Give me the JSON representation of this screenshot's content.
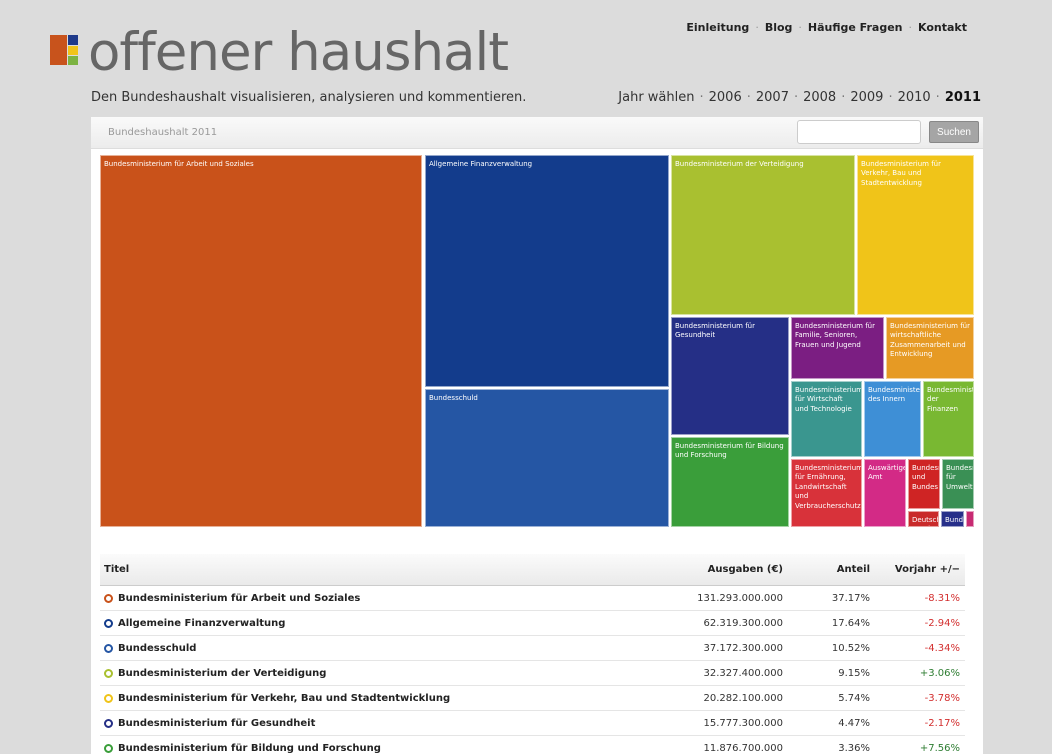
{
  "logo": {
    "text": "offener haushalt",
    "tagline": "Den Bundeshaushalt visualisieren, analysieren und kommentieren."
  },
  "nav": {
    "items": [
      "Einleitung",
      "Blog",
      "Häufige Fragen",
      "Kontakt"
    ],
    "separator": "·"
  },
  "years": {
    "label": "Jahr wählen",
    "items": [
      "2006",
      "2007",
      "2008",
      "2009",
      "2010",
      "2011"
    ],
    "active": "2011"
  },
  "panel": {
    "title": "Bundeshaushalt 2011",
    "search_placeholder": "",
    "search_button": "Suchen"
  },
  "treemap": [
    {
      "label": "Bundesministerium für Arbeit und Soziales",
      "color": "#c9521a"
    },
    {
      "label": "Allgemeine Finanzverwaltung",
      "color": "#133c8c"
    },
    {
      "label": "Bundesschuld",
      "color": "#2556a4"
    },
    {
      "label": "Bundesministerium der Verteidigung",
      "color": "#a9c030"
    },
    {
      "label": "Bundesministerium für Verkehr, Bau und Stadtentwicklung",
      "color": "#f0c419"
    },
    {
      "label": "Bundesministerium für Gesundheit",
      "color": "#252f86"
    },
    {
      "label": "Bundesministerium für Familie, Senioren, Frauen und Jugend",
      "color": "#7b1e82"
    },
    {
      "label": "Bundesministerium für wirtschaftliche Zusammenarbeit und Entwicklung",
      "color": "#e69a24"
    },
    {
      "label": "Bundesministerium für Bildung und Forschung",
      "color": "#3a9e3a"
    },
    {
      "label": "Bundesministerium für Wirtschaft und Technologie",
      "color": "#3a968f"
    },
    {
      "label": "Bundesministerium des Innern",
      "color": "#3e8fd6"
    },
    {
      "label": "Bundesministerium der Finanzen",
      "color": "#79b832"
    },
    {
      "label": "Bundesministerium für Ernährung, Landwirtschaft und Verbraucherschutz",
      "color": "#d8323a"
    },
    {
      "label": "Auswärtiges Amt",
      "color": "#d32a86"
    },
    {
      "label": "Bundesministerium und Bundes",
      "color": "#cf2424"
    },
    {
      "label": "Bundesministerium für Umwelt",
      "color": "#3a9055"
    },
    {
      "label": "Deutscher Bundestag",
      "color": "#c92a2a"
    },
    {
      "label": "Bundes",
      "color": "#272f8a"
    },
    {
      "label": "",
      "color": "#c72a72"
    }
  ],
  "table": {
    "headers": {
      "title": "Titel",
      "amount": "Ausgaben (€)",
      "share": "Anteil",
      "change": "Vorjahr +/−"
    },
    "rows": [
      {
        "title": "Bundesministerium für Arbeit und Soziales",
        "amount": "131.293.000.000",
        "share": "37.17%",
        "change": "-8.31%",
        "dir": "neg",
        "color": "#c9521a"
      },
      {
        "title": "Allgemeine Finanzverwaltung",
        "amount": "62.319.300.000",
        "share": "17.64%",
        "change": "-2.94%",
        "dir": "neg",
        "color": "#133c8c"
      },
      {
        "title": "Bundesschuld",
        "amount": "37.172.300.000",
        "share": "10.52%",
        "change": "-4.34%",
        "dir": "neg",
        "color": "#2556a4"
      },
      {
        "title": "Bundesministerium der Verteidigung",
        "amount": "32.327.400.000",
        "share": "9.15%",
        "change": "+3.06%",
        "dir": "pos",
        "color": "#a9c030"
      },
      {
        "title": "Bundesministerium für Verkehr, Bau und Stadtentwicklung",
        "amount": "20.282.100.000",
        "share": "5.74%",
        "change": "-3.78%",
        "dir": "neg",
        "color": "#f0c419"
      },
      {
        "title": "Bundesministerium für Gesundheit",
        "amount": "15.777.300.000",
        "share": "4.47%",
        "change": "-2.17%",
        "dir": "neg",
        "color": "#252f86"
      },
      {
        "title": "Bundesministerium für Bildung und Forschung",
        "amount": "11.876.700.000",
        "share": "3.36%",
        "change": "+7.56%",
        "dir": "pos",
        "color": "#3a9e3a"
      }
    ]
  }
}
